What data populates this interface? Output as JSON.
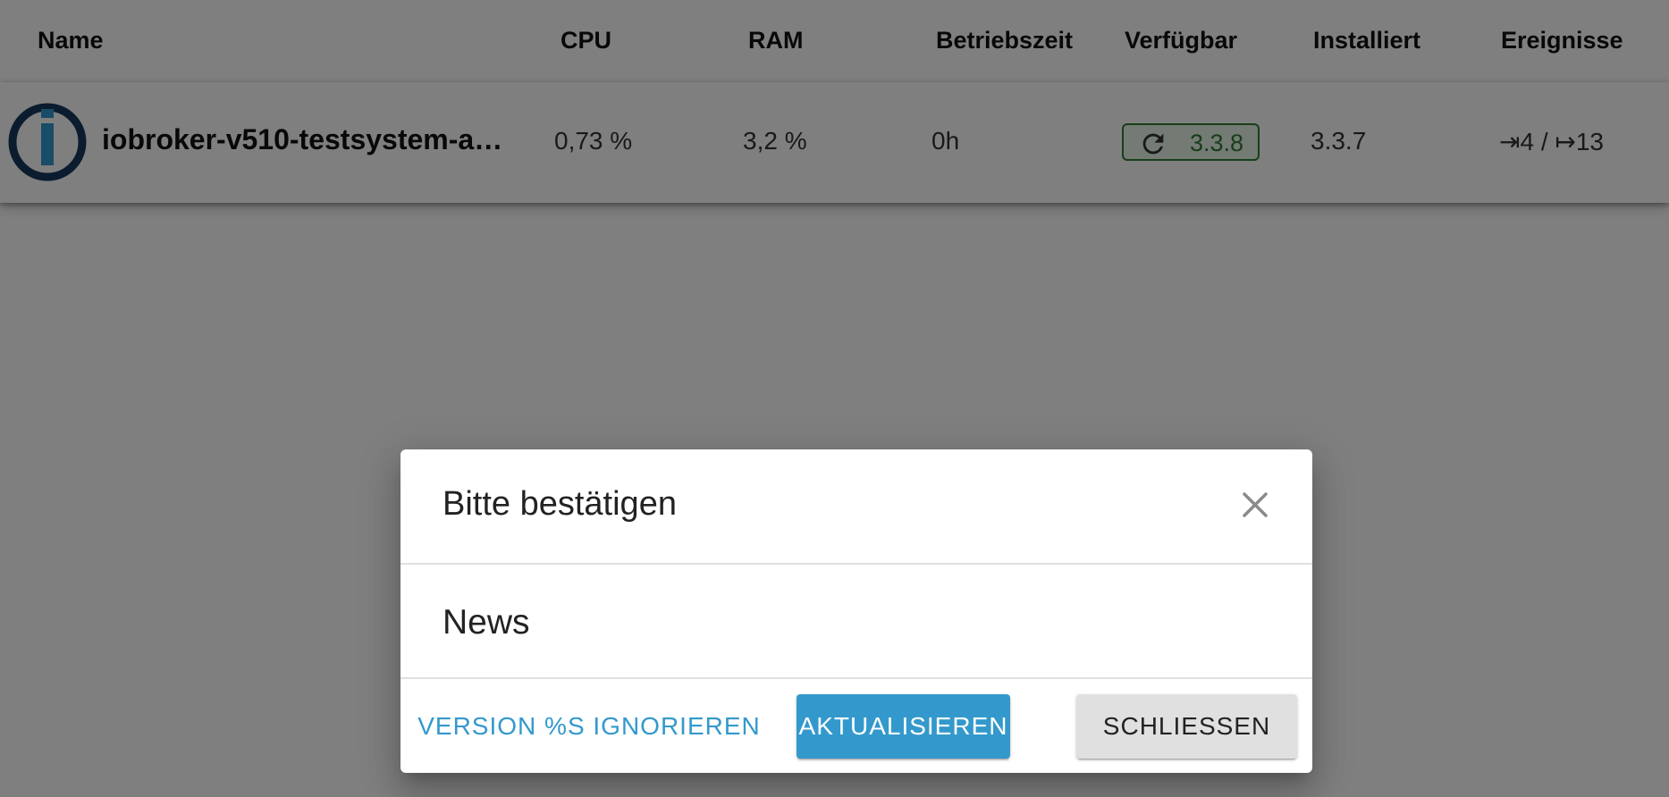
{
  "table": {
    "columns": {
      "name": "Name",
      "cpu": "CPU",
      "ram": "RAM",
      "uptime": "Betriebszeit",
      "available": "Verfügbar",
      "installed": "Installiert",
      "events": "Ereignisse"
    },
    "host": {
      "logo_icon": "iobroker-logo-icon",
      "name": "iobroker-v510-testsystem-a…",
      "cpu": "0,73 %",
      "ram": "3,2 %",
      "uptime": "0h",
      "available_icon": "refresh-icon",
      "available": "3.3.8",
      "installed": "3.3.7",
      "events": "⇥4 / ↦13"
    }
  },
  "dialog": {
    "title": "Bitte bestätigen",
    "close_icon": "close-icon",
    "content": "News",
    "buttons": {
      "ignore": "VERSION %S IGNORIEREN",
      "update": "AKTUALISIEREN",
      "close": "SCHLIESSEN"
    }
  },
  "colors": {
    "primary": "#3399cc",
    "available_green": "#2e7d32",
    "backdrop": "rgba(0,0,0,0.5)"
  }
}
